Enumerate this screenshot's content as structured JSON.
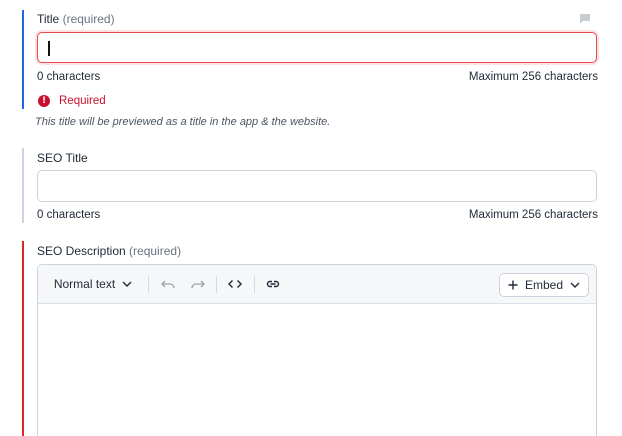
{
  "title_field": {
    "label": "Title",
    "required_note": "(required)",
    "value": "",
    "char_count": "0 characters",
    "max_chars": "Maximum 256 characters",
    "error": "Required",
    "hint": "This title will be previewed as a title in the app & the website."
  },
  "seo_title_field": {
    "label": "SEO Title",
    "value": "",
    "char_count": "0 characters",
    "max_chars": "Maximum 256 characters"
  },
  "seo_description_field": {
    "label": "SEO Description",
    "required_note": "(required)",
    "toolbar": {
      "text_style": "Normal text",
      "undo_icon": "undo-icon",
      "redo_icon": "redo-icon",
      "code_icon": "code-icon",
      "link_icon": "link-icon",
      "embed_label": "Embed"
    }
  },
  "colors": {
    "active_bar": "#2563eb",
    "neutral_bar": "#cbd5e1",
    "error_bar": "#dc2626",
    "error_text": "#c8102e"
  }
}
